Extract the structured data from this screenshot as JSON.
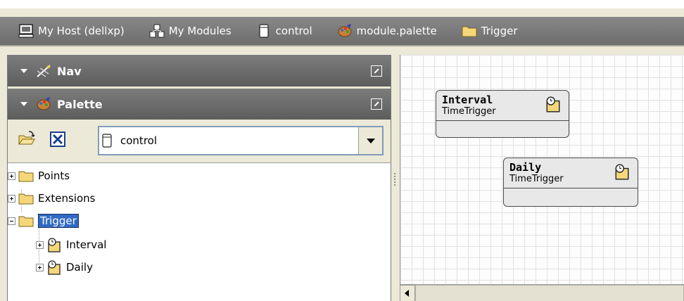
{
  "breadcrumbs": [
    {
      "label": "My Host (dellxp)",
      "icon": "computer-icon"
    },
    {
      "label": "My Modules",
      "icon": "modules-icon"
    },
    {
      "label": "control",
      "icon": "module-jar-icon"
    },
    {
      "label": "module.palette",
      "icon": "palette-icon"
    },
    {
      "label": "Trigger",
      "icon": "folder-icon"
    }
  ],
  "panes": {
    "nav": {
      "title": "Nav",
      "icon": "nav-icon"
    },
    "palette": {
      "title": "Palette",
      "icon": "palette-icon"
    }
  },
  "palette_toolbar": {
    "open_icon": "open-folder-icon",
    "close_icon": "close-x-icon",
    "selected_module": "control"
  },
  "tree": [
    {
      "label": "Points",
      "expanded": false
    },
    {
      "label": "Extensions",
      "expanded": false
    },
    {
      "label": "Trigger",
      "expanded": true,
      "selected": true,
      "children": [
        {
          "label": "Interval"
        },
        {
          "label": "Daily"
        }
      ]
    }
  ],
  "wiresheet": {
    "components": [
      {
        "name": "Interval",
        "type": "TimeTrigger"
      },
      {
        "name": "Daily",
        "type": "TimeTrigger"
      }
    ]
  },
  "colors": {
    "header_gray": "#6d6d6d",
    "selection_blue": "#316ac5",
    "folder_yellow": "#f5d77a"
  }
}
